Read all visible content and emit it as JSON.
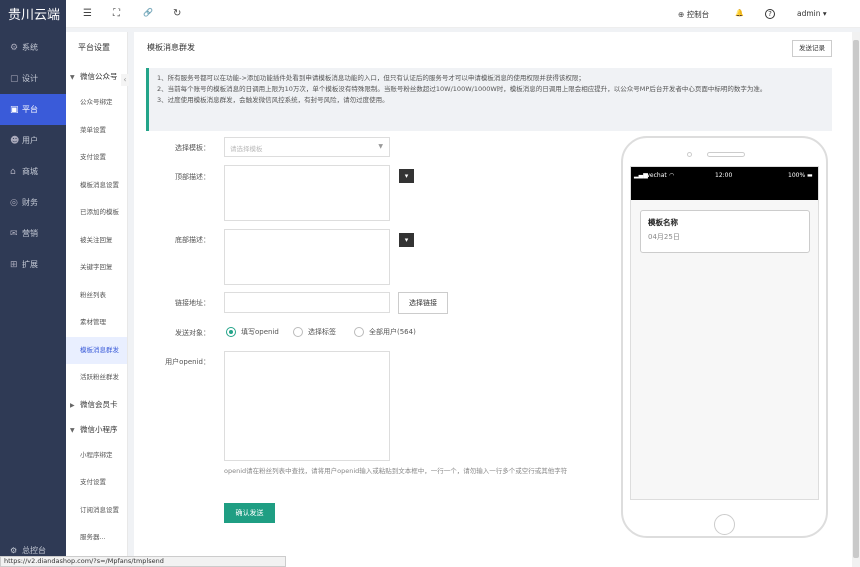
{
  "brand": "贵川云端",
  "sidebar": {
    "items": [
      {
        "icon": "gear-icon",
        "glyph": "⚙",
        "label": "系统",
        "active": false
      },
      {
        "icon": "design-icon",
        "glyph": "▢",
        "label": "设计",
        "active": false
      },
      {
        "icon": "platform-icon",
        "glyph": "▣",
        "label": "平台",
        "active": true
      },
      {
        "icon": "user-icon",
        "glyph": "☻",
        "label": "用户",
        "active": false
      },
      {
        "icon": "shop-icon",
        "glyph": "⌂",
        "label": "商城",
        "active": false
      },
      {
        "icon": "finance-icon",
        "glyph": "◎",
        "label": "财务",
        "active": false
      },
      {
        "icon": "marketing-icon",
        "glyph": "✉",
        "label": "营销",
        "active": false
      },
      {
        "icon": "extend-icon",
        "glyph": "⊞",
        "label": "扩展",
        "active": false
      }
    ],
    "footer": {
      "glyph": "⚙",
      "label": "总控台"
    }
  },
  "subnav": {
    "title": "平台设置",
    "collapse_glyph": "‹",
    "groups": [
      {
        "label": "微信公众号",
        "expanded": true,
        "items": [
          "公众号绑定",
          "菜单设置",
          "支付设置",
          "模板消息设置",
          "已添加的模板",
          "被关注回复",
          "关键字回复",
          "粉丝列表",
          "素材管理",
          "模板消息群发",
          "活跃粉丝群发"
        ]
      },
      {
        "label": "微信会员卡",
        "expanded": false,
        "items": []
      },
      {
        "label": "微信小程序",
        "expanded": true,
        "items": [
          "小程序绑定",
          "支付设置",
          "订阅消息设置",
          "服务器..."
        ]
      }
    ],
    "active_item": "模板消息群发"
  },
  "topbar": {
    "menu_glyph": "☰",
    "fullscreen_glyph": "⛶",
    "link_glyph": "🔗",
    "refresh_glyph": "↻",
    "console_glyph": "⊕",
    "console_label": "控制台",
    "bell_glyph": "🔔",
    "help_glyph": "?",
    "user_label": "admin",
    "user_caret": "▾"
  },
  "page": {
    "title": "模板消息群发",
    "records_button": "发送记录",
    "notice": [
      "1、所有服务号都可以在功能->添加功能插件处看到申请模板消息功能的入口，但只有认证后的服务号才可以申请模板消息的使用权限并获得该权限；",
      "2、当前每个账号的模板消息的日调用上限为10万次，单个模板没有特殊限制。当账号粉丝数超过10W/100W/1000W时，模板消息的日调用上限会相应提升，以公众号MP后台开发者中心页面中标明的数字为准。",
      "3、过度使用模板消息群发，会触发微信风控系统，有封号风险，请勿过度使用。"
    ],
    "form": {
      "template_label": "选择模板：",
      "template_placeholder": "请选择模板",
      "template_arrow": "▼",
      "header_label": "顶部描述：",
      "footer_label": "底部描述：",
      "color_glyph": "▾",
      "link_label": "链接地址：",
      "link_value": "",
      "pick_link_button": "选择链接",
      "target_label": "发送对象：",
      "radios": [
        {
          "label": "填写openid",
          "checked": true
        },
        {
          "label": "选择标签",
          "checked": false
        },
        {
          "label": "全部用户(564)",
          "checked": false
        }
      ],
      "openid_label": "用户openid：",
      "openid_value": "",
      "hint": "openid请在粉丝列表中查找，请将用户openid输入或粘贴到文本框中，一行一个，请勿输入一行多个或空行或其他字符",
      "submit_button": "确认发送"
    },
    "preview": {
      "carrier": "wechat",
      "signal_glyph": "▂▄▆",
      "wifi_glyph": "◠",
      "time": "12:00",
      "battery": "100%",
      "battery_glyph": "▬",
      "template_name": "模板名称",
      "date": "04月25日"
    }
  },
  "statusbar_url": "https://v2.diandashop.com/?s=/Mpfans/tmplsend",
  "colors": {
    "sidebar": "#2f3a55",
    "active": "#3a5bd9",
    "accent": "#23a489",
    "submit": "#1f9e83"
  }
}
